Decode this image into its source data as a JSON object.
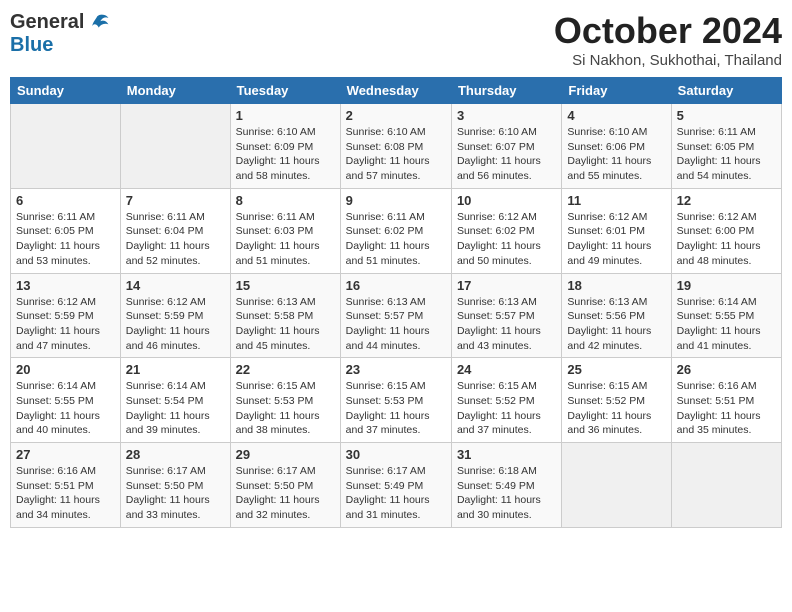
{
  "header": {
    "logo_general": "General",
    "logo_blue": "Blue",
    "month": "October 2024",
    "location": "Si Nakhon, Sukhothai, Thailand"
  },
  "weekdays": [
    "Sunday",
    "Monday",
    "Tuesday",
    "Wednesday",
    "Thursday",
    "Friday",
    "Saturday"
  ],
  "weeks": [
    [
      {
        "day": "",
        "info": ""
      },
      {
        "day": "",
        "info": ""
      },
      {
        "day": "1",
        "info": "Sunrise: 6:10 AM\nSunset: 6:09 PM\nDaylight: 11 hours and 58 minutes."
      },
      {
        "day": "2",
        "info": "Sunrise: 6:10 AM\nSunset: 6:08 PM\nDaylight: 11 hours and 57 minutes."
      },
      {
        "day": "3",
        "info": "Sunrise: 6:10 AM\nSunset: 6:07 PM\nDaylight: 11 hours and 56 minutes."
      },
      {
        "day": "4",
        "info": "Sunrise: 6:10 AM\nSunset: 6:06 PM\nDaylight: 11 hours and 55 minutes."
      },
      {
        "day": "5",
        "info": "Sunrise: 6:11 AM\nSunset: 6:05 PM\nDaylight: 11 hours and 54 minutes."
      }
    ],
    [
      {
        "day": "6",
        "info": "Sunrise: 6:11 AM\nSunset: 6:05 PM\nDaylight: 11 hours and 53 minutes."
      },
      {
        "day": "7",
        "info": "Sunrise: 6:11 AM\nSunset: 6:04 PM\nDaylight: 11 hours and 52 minutes."
      },
      {
        "day": "8",
        "info": "Sunrise: 6:11 AM\nSunset: 6:03 PM\nDaylight: 11 hours and 51 minutes."
      },
      {
        "day": "9",
        "info": "Sunrise: 6:11 AM\nSunset: 6:02 PM\nDaylight: 11 hours and 51 minutes."
      },
      {
        "day": "10",
        "info": "Sunrise: 6:12 AM\nSunset: 6:02 PM\nDaylight: 11 hours and 50 minutes."
      },
      {
        "day": "11",
        "info": "Sunrise: 6:12 AM\nSunset: 6:01 PM\nDaylight: 11 hours and 49 minutes."
      },
      {
        "day": "12",
        "info": "Sunrise: 6:12 AM\nSunset: 6:00 PM\nDaylight: 11 hours and 48 minutes."
      }
    ],
    [
      {
        "day": "13",
        "info": "Sunrise: 6:12 AM\nSunset: 5:59 PM\nDaylight: 11 hours and 47 minutes."
      },
      {
        "day": "14",
        "info": "Sunrise: 6:12 AM\nSunset: 5:59 PM\nDaylight: 11 hours and 46 minutes."
      },
      {
        "day": "15",
        "info": "Sunrise: 6:13 AM\nSunset: 5:58 PM\nDaylight: 11 hours and 45 minutes."
      },
      {
        "day": "16",
        "info": "Sunrise: 6:13 AM\nSunset: 5:57 PM\nDaylight: 11 hours and 44 minutes."
      },
      {
        "day": "17",
        "info": "Sunrise: 6:13 AM\nSunset: 5:57 PM\nDaylight: 11 hours and 43 minutes."
      },
      {
        "day": "18",
        "info": "Sunrise: 6:13 AM\nSunset: 5:56 PM\nDaylight: 11 hours and 42 minutes."
      },
      {
        "day": "19",
        "info": "Sunrise: 6:14 AM\nSunset: 5:55 PM\nDaylight: 11 hours and 41 minutes."
      }
    ],
    [
      {
        "day": "20",
        "info": "Sunrise: 6:14 AM\nSunset: 5:55 PM\nDaylight: 11 hours and 40 minutes."
      },
      {
        "day": "21",
        "info": "Sunrise: 6:14 AM\nSunset: 5:54 PM\nDaylight: 11 hours and 39 minutes."
      },
      {
        "day": "22",
        "info": "Sunrise: 6:15 AM\nSunset: 5:53 PM\nDaylight: 11 hours and 38 minutes."
      },
      {
        "day": "23",
        "info": "Sunrise: 6:15 AM\nSunset: 5:53 PM\nDaylight: 11 hours and 37 minutes."
      },
      {
        "day": "24",
        "info": "Sunrise: 6:15 AM\nSunset: 5:52 PM\nDaylight: 11 hours and 37 minutes."
      },
      {
        "day": "25",
        "info": "Sunrise: 6:15 AM\nSunset: 5:52 PM\nDaylight: 11 hours and 36 minutes."
      },
      {
        "day": "26",
        "info": "Sunrise: 6:16 AM\nSunset: 5:51 PM\nDaylight: 11 hours and 35 minutes."
      }
    ],
    [
      {
        "day": "27",
        "info": "Sunrise: 6:16 AM\nSunset: 5:51 PM\nDaylight: 11 hours and 34 minutes."
      },
      {
        "day": "28",
        "info": "Sunrise: 6:17 AM\nSunset: 5:50 PM\nDaylight: 11 hours and 33 minutes."
      },
      {
        "day": "29",
        "info": "Sunrise: 6:17 AM\nSunset: 5:50 PM\nDaylight: 11 hours and 32 minutes."
      },
      {
        "day": "30",
        "info": "Sunrise: 6:17 AM\nSunset: 5:49 PM\nDaylight: 11 hours and 31 minutes."
      },
      {
        "day": "31",
        "info": "Sunrise: 6:18 AM\nSunset: 5:49 PM\nDaylight: 11 hours and 30 minutes."
      },
      {
        "day": "",
        "info": ""
      },
      {
        "day": "",
        "info": ""
      }
    ]
  ]
}
